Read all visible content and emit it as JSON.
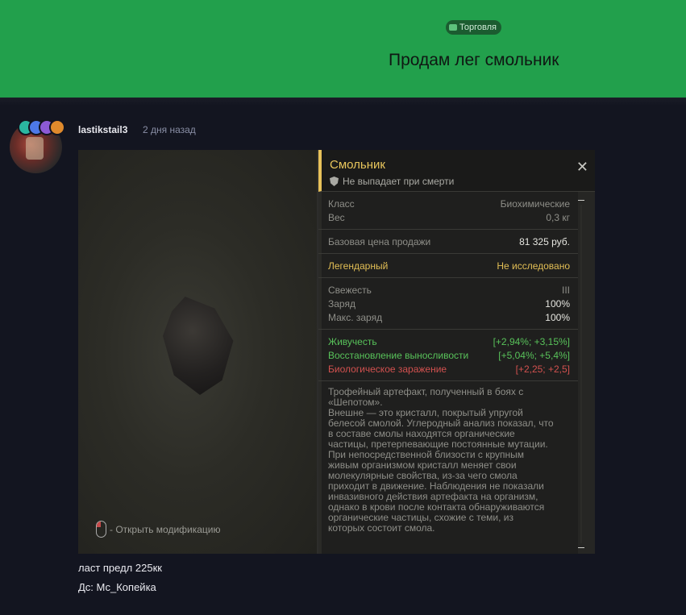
{
  "thread": {
    "tag": "Торговля",
    "title": "Продам лег смольник",
    "colors": {
      "header_bg": "#22a04c",
      "tag_bg": "#1b5c30"
    }
  },
  "post": {
    "username": "lastikstail3",
    "timestamp": "2 дня назад",
    "badges": [
      {
        "color": "#2bb7a1"
      },
      {
        "color": "#4d79e8"
      },
      {
        "color": "#8c5ad6"
      },
      {
        "color": "#e08a2c"
      }
    ],
    "lines": [
      "ласт предл 225кк",
      "Дс: Мс_Копейка"
    ]
  },
  "item": {
    "name": "Смольник",
    "no_drop": "Не выпадает при смерти",
    "mouse_hint": "- Открыть модификацию",
    "sections": [
      [
        {
          "label": "Класс",
          "value": "Биохимические",
          "style": ""
        },
        {
          "label": "Вес",
          "value": "0,3 кг",
          "style": ""
        }
      ],
      [
        {
          "label": "Базовая цена продажи",
          "value": "81 325 руб.",
          "style": "white"
        }
      ],
      [
        {
          "label": "Легендарный",
          "value": "Не исследовано",
          "style": "gold",
          "label_style": "gold"
        }
      ],
      [
        {
          "label": "Свежесть",
          "value": "III",
          "style": ""
        },
        {
          "label": "Заряд",
          "value": "100%",
          "style": "white"
        },
        {
          "label": "Макс. заряд",
          "value": "100%",
          "style": "white"
        }
      ],
      [
        {
          "label": "Живучесть",
          "value": "[+2,94%; +3,15%]",
          "style": "green",
          "label_style": "green"
        },
        {
          "label": "Восстановление выносливости",
          "value": "[+5,04%; +5,4%]",
          "style": "green",
          "label_style": "green"
        },
        {
          "label": "Биологическое заражение",
          "value": "[+2,25; +2,5]",
          "style": "red",
          "label_style": "red"
        }
      ]
    ],
    "description": [
      "Трофейный артефакт, полученный в боях с",
      "«Шепотом».",
      "Внешне — это кристалл, покрытый упругой",
      "белесой смолой. Углеродный анализ показал, что",
      "в составе смолы находятся органические",
      "частицы, претерпевающие постоянные мутации.",
      "При непосредственной близости с крупным",
      "живым организмом кристалл меняет свои",
      "молекулярные свойства, из-за чего смола",
      "приходит в движение. Наблюдения не показали",
      "инвазивного действия артефакта на организм,",
      "однако в крови после контакта обнаруживаются",
      "органические частицы, схожие с теми, из",
      "которых состоит смола."
    ]
  }
}
